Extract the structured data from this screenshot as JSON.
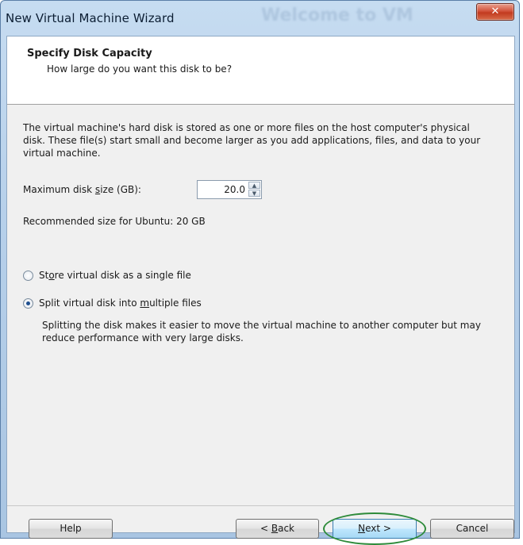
{
  "window": {
    "title": "New Virtual Machine Wizard",
    "background_title": "Welcome to VM",
    "close_glyph": "✕"
  },
  "header": {
    "title": "Specify Disk Capacity",
    "subtitle": "How large do you want this disk to be?"
  },
  "content": {
    "description": "The virtual machine's hard disk is stored as one or more files on the host computer's physical disk. These file(s) start small and become larger as you add applications, files, and data to your virtual machine.",
    "max_size_label_pre": "Maximum disk ",
    "max_size_label_accel": "s",
    "max_size_label_post": "ize (GB):",
    "max_size_value": "20.0",
    "recommended": "Recommended size for Ubuntu: 20 GB",
    "options": [
      {
        "label_pre": "St",
        "label_accel": "o",
        "label_post": "re virtual disk as a single file",
        "checked": false
      },
      {
        "label_pre": "Split virtual disk into ",
        "label_accel": "m",
        "label_post": "ultiple files",
        "checked": true
      }
    ],
    "split_description": "Splitting the disk makes it easier to move the virtual machine to another computer but may reduce performance with very large disks."
  },
  "buttons": {
    "help": "Help",
    "back_pre": "< ",
    "back_accel": "B",
    "back_post": "ack",
    "next_accel": "N",
    "next_post": "ext >",
    "cancel": "Cancel"
  },
  "colors": {
    "highlight_ring": "#2e8b3a",
    "close_button": "#c23a1f"
  }
}
